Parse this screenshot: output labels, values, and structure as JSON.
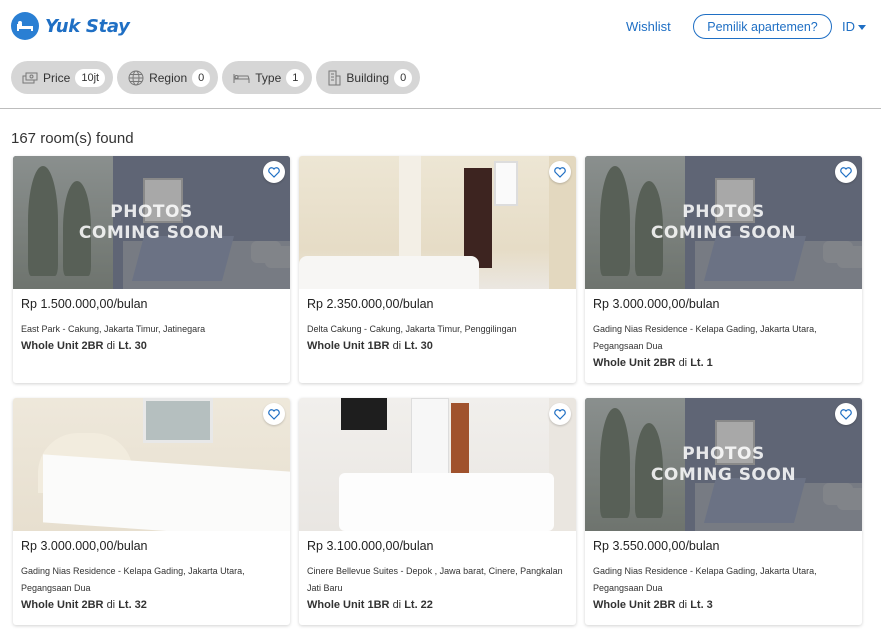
{
  "header": {
    "logo_text": "Yuk Stay",
    "wishlist_label": "Wishlist",
    "owner_button_label": "Pemilik apartemen?",
    "language_label": "ID"
  },
  "filters": [
    {
      "label": "Price",
      "value": "10jt",
      "icon": "money-icon"
    },
    {
      "label": "Region",
      "value": "0",
      "icon": "globe-icon"
    },
    {
      "label": "Type",
      "value": "1",
      "icon": "bed-icon"
    },
    {
      "label": "Building",
      "value": "0",
      "icon": "building-icon"
    }
  ],
  "results_text": "167 room(s) found",
  "photo_placeholder": {
    "line1": "PHOTOS",
    "line2": "COMING SOON"
  },
  "listings": [
    {
      "price": "Rp 1.500.000,00/bulan",
      "location": "East Park - Cakung, Jakarta Timur, Jatinegara",
      "unit": "Whole Unit 2BR",
      "floor_prefix": "di",
      "floor": "Lt. 30",
      "photo": "placeholder"
    },
    {
      "price": "Rp 2.350.000,00/bulan",
      "location": "Delta Cakung - Cakung, Jakarta Timur, Penggilingan",
      "unit": "Whole Unit 1BR",
      "floor_prefix": "di",
      "floor": "Lt. 30",
      "photo": "room"
    },
    {
      "price": "Rp 3.000.000,00/bulan",
      "location": "Gading Nias Residence - Kelapa Gading, Jakarta Utara, Pegangsaan Dua",
      "unit": "Whole Unit 2BR",
      "floor_prefix": "di",
      "floor": "Lt. 1",
      "photo": "placeholder"
    },
    {
      "price": "Rp 3.000.000,00/bulan",
      "location": "Gading Nias Residence - Kelapa Gading, Jakarta Utara, Pegangsaan Dua",
      "unit": "Whole Unit 2BR",
      "floor_prefix": "di",
      "floor": "Lt. 32",
      "photo": "room"
    },
    {
      "price": "Rp 3.100.000,00/bulan",
      "location": "Cinere Bellevue Suites - Depok , Jawa barat, Cinere, Pangkalan Jati Baru",
      "unit": "Whole Unit 1BR",
      "floor_prefix": "di",
      "floor": "Lt. 22",
      "photo": "room"
    },
    {
      "price": "Rp 3.550.000,00/bulan",
      "location": "Gading Nias Residence - Kelapa Gading, Jakarta Utara, Pegangsaan Dua",
      "unit": "Whole Unit 2BR",
      "floor_prefix": "di",
      "floor": "Lt. 3",
      "photo": "placeholder"
    }
  ],
  "colors": {
    "brand": "#1f6fc4",
    "chip_bg": "#d6d6d6"
  }
}
